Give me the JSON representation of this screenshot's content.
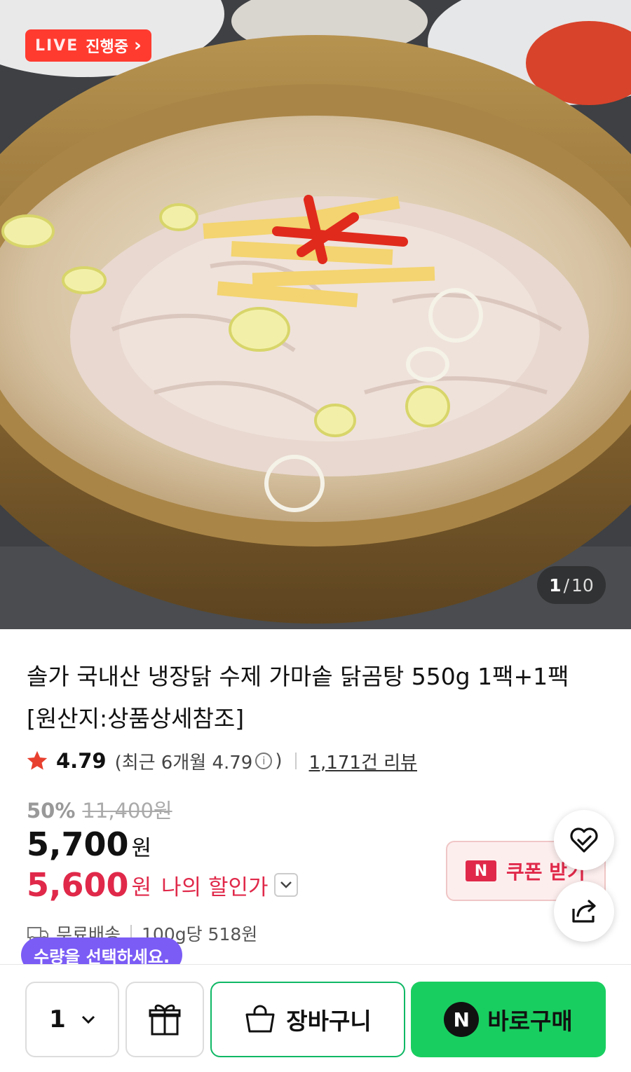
{
  "live": {
    "label": "LIVE",
    "status": "진행중"
  },
  "image_counter": {
    "current": "1",
    "separator": "/",
    "total": "10"
  },
  "product": {
    "title_line1": "솔가 국내산 냉장닭 수제 가마솥 닭곰탕 550g 1팩+1팩",
    "title_line2": "[원산지:상품상세참조]"
  },
  "rating": {
    "score": "4.79",
    "recent_prefix": "(최근 6개월 4.79",
    "recent_suffix": ")",
    "info_glyph": "i",
    "reviews": "1,171건 리뷰"
  },
  "price": {
    "discount_rate": "50%",
    "original": "11,400원",
    "sale": "5,700",
    "sale_unit": "원",
    "my_price": "5,600",
    "my_price_unit": "원",
    "my_price_label": "나의 할인가"
  },
  "coupon": {
    "badge": "N",
    "label": "쿠폰 받기"
  },
  "shipping": {
    "label": "무료배송",
    "unit_price": "100g당 518원"
  },
  "tooltip": "수량을 선택하세요.",
  "bottom_bar": {
    "quantity": "1",
    "cart_label": "장바구니",
    "buy_badge": "N",
    "buy_label": "바로구매"
  },
  "colors": {
    "accent_red": "#e0294a",
    "live_red": "#ff3b30",
    "buy_green": "#19ce60",
    "tooltip_purple": "#7b5cf5"
  },
  "icons": [
    "star-icon",
    "info-icon",
    "heart-check-icon",
    "share-icon",
    "truck-icon",
    "gift-icon",
    "cart-icon",
    "chevron-down-icon"
  ]
}
